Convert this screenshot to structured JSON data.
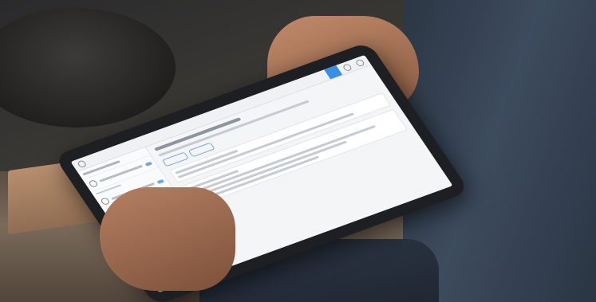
{
  "scene": {
    "description_icons": [
      "tablet",
      "hands",
      "counter",
      "tray",
      "business-cards"
    ]
  }
}
